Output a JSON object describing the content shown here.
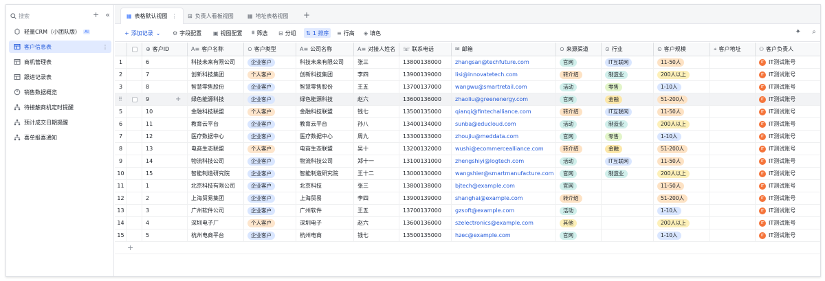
{
  "sidebar": {
    "search_placeholder": "搜索",
    "add_symbol": "+",
    "collapse_symbol": "«",
    "items": [
      {
        "label": "轻量CRM（小团队版）",
        "badge": "AI",
        "icon": "app-icon"
      },
      {
        "label": "客户信息表",
        "icon": "table-icon",
        "active": true,
        "more": "⋮"
      },
      {
        "label": "商机管理表",
        "icon": "table-icon"
      },
      {
        "label": "跟进记录表",
        "icon": "table-icon"
      },
      {
        "label": "销售数据概览",
        "icon": "dashboard-icon"
      },
      {
        "label": "待接触商机定时提醒",
        "icon": "workflow-icon"
      },
      {
        "label": "预计成交日期提醒",
        "icon": "workflow-icon"
      },
      {
        "label": "喜单报喜通知",
        "icon": "workflow-icon"
      }
    ]
  },
  "tabs": [
    {
      "label": "表格默认视图",
      "more": "⋮"
    },
    {
      "label": "负责人看板视图"
    },
    {
      "label": "地址表格视图"
    }
  ],
  "tab_add": "+",
  "toolbar": {
    "add_record": "添加记录",
    "field_config": "字段配置",
    "view_config": "视图配置",
    "filter": "筛选",
    "group": "分组",
    "sort": "1 排序",
    "row_height": "行高",
    "fill": "填色"
  },
  "columns": [
    "客户ID",
    "客户名称",
    "客户类型",
    "公司名称",
    "对接人姓名",
    "联系电话",
    "邮箱",
    "来源渠道",
    "行业",
    "客户规模",
    "客户地址",
    "客户负责人"
  ],
  "rows": [
    {
      "idx": "1",
      "id": "6",
      "name": "科技未来有限公司",
      "type": "企业客户",
      "company": "科技未来有限公司",
      "contact": "张三",
      "phone": "13800138000",
      "email": "zhangsan@techfuture.com",
      "source": "官网",
      "industry": "IT互联网",
      "scale": "11-50人",
      "owner": "IT测试账号"
    },
    {
      "idx": "2",
      "id": "7",
      "name": "创新科技集团",
      "type": "个人客户",
      "company": "创新科技集团",
      "contact": "李四",
      "phone": "13900139000",
      "email": "lisi@innovatetech.com",
      "source": "转介绍",
      "industry": "制造业",
      "scale": "200人以上",
      "owner": "IT测试账号"
    },
    {
      "idx": "3",
      "id": "8",
      "name": "智慧零售股份",
      "type": "企业客户",
      "company": "智慧零售股份",
      "contact": "王五",
      "phone": "13700137000",
      "email": "wangwu@smartretail.com",
      "source": "活动",
      "industry": "零售",
      "scale": "1-10人",
      "owner": "IT测试账号"
    },
    {
      "idx": "4",
      "id": "9",
      "name": "绿色能源科技",
      "type": "企业客户",
      "company": "绿色能源科技",
      "contact": "赵六",
      "phone": "13600136000",
      "email": "zhaoliu@greenenergy.com",
      "source": "官网",
      "industry": "金融",
      "scale": "51-200人",
      "owner": "IT测试账号"
    },
    {
      "idx": "5",
      "id": "10",
      "name": "金融科技联盟",
      "type": "个人客户",
      "company": "金融科技联盟",
      "contact": "钱七",
      "phone": "13500135000",
      "email": "qianqi@fintechalliance.com",
      "source": "转介绍",
      "industry": "IT互联网",
      "scale": "11-50人",
      "owner": "IT测试账号"
    },
    {
      "idx": "6",
      "id": "11",
      "name": "教育云平台",
      "type": "企业客户",
      "company": "教育云平台",
      "contact": "孙八",
      "phone": "13400134000",
      "email": "sunba@educloud.com",
      "source": "活动",
      "industry": "制造业",
      "scale": "200人以上",
      "owner": "IT测试账号"
    },
    {
      "idx": "7",
      "id": "12",
      "name": "医疗数据中心",
      "type": "企业客户",
      "company": "医疗数据中心",
      "contact": "周九",
      "phone": "13300133000",
      "email": "zhoujiu@meddata.com",
      "source": "官网",
      "industry": "零售",
      "scale": "1-10人",
      "owner": "IT测试账号"
    },
    {
      "idx": "8",
      "id": "13",
      "name": "电商生态联盟",
      "type": "个人客户",
      "company": "电商生态联盟",
      "contact": "吴十",
      "phone": "13200132000",
      "email": "wushi@ecommercealliance.com",
      "source": "转介绍",
      "industry": "金融",
      "scale": "51-200人",
      "owner": "IT测试账号"
    },
    {
      "idx": "9",
      "id": "14",
      "name": "物流科技公司",
      "type": "企业客户",
      "company": "物流科技公司",
      "contact": "郑十一",
      "phone": "13100131000",
      "email": "zhengshiyi@logtech.com",
      "source": "活动",
      "industry": "IT互联网",
      "scale": "11-50人",
      "owner": "IT测试账号"
    },
    {
      "idx": "10",
      "id": "15",
      "name": "智能制造研究院",
      "type": "企业客户",
      "company": "智能制造研究院",
      "contact": "王十二",
      "phone": "13000130000",
      "email": "wangshier@smartmanufacture.com",
      "source": "官网",
      "industry": "制造业",
      "scale": "200人以上",
      "owner": "IT测试账号"
    },
    {
      "idx": "11",
      "id": "1",
      "name": "北京科技有限公司",
      "type": "企业客户",
      "company": "北京科技",
      "contact": "张三",
      "phone": "13800138000",
      "email": "bjtech@example.com",
      "source": "官网",
      "industry": "",
      "scale": "11-50人",
      "owner": "IT测试账号"
    },
    {
      "idx": "12",
      "id": "2",
      "name": "上海贸易集团",
      "type": "企业客户",
      "company": "上海贸易",
      "contact": "李四",
      "phone": "13900139000",
      "email": "shanghai@example.com",
      "source": "转介绍",
      "industry": "",
      "scale": "51-200人",
      "owner": "IT测试账号"
    },
    {
      "idx": "13",
      "id": "3",
      "name": "广州软件公司",
      "type": "企业客户",
      "company": "广州软件",
      "contact": "王五",
      "phone": "13700137000",
      "email": "gzsoft@example.com",
      "source": "活动",
      "industry": "",
      "scale": "1-10人",
      "owner": "IT测试账号"
    },
    {
      "idx": "14",
      "id": "4",
      "name": "深圳电子厂",
      "type": "个人客户",
      "company": "深圳电子",
      "contact": "赵六",
      "phone": "13600136000",
      "email": "szelectronics@example.com",
      "source": "其他",
      "industry": "",
      "scale": "200人以上",
      "owner": "IT测试账号"
    },
    {
      "idx": "15",
      "id": "5",
      "name": "杭州电商平台",
      "type": "企业客户",
      "company": "杭州电商",
      "contact": "钱七",
      "phone": "13500135000",
      "email": "hzec@example.com",
      "source": "官网",
      "industry": "",
      "scale": "1-10人",
      "owner": "IT测试账号"
    }
  ],
  "avatar_text": "IT",
  "add_row_symbol": "+",
  "colors": {
    "accent": "#245bdb",
    "active_bg": "#e1eaff",
    "avatar": "#f5743a"
  }
}
